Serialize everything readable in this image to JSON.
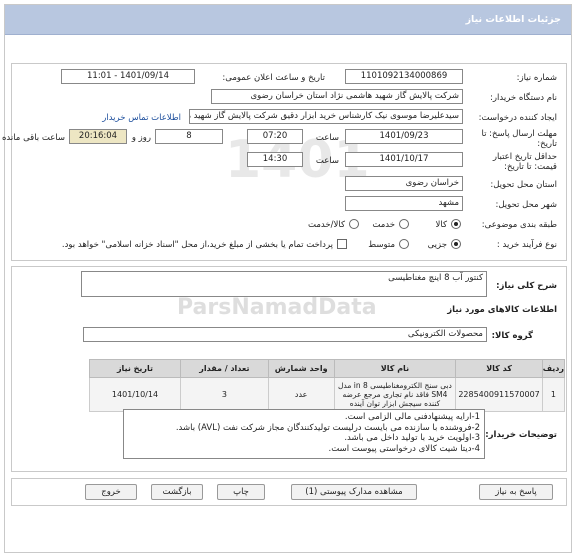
{
  "header": {
    "title": "جزئیات اطلاعات نیاز"
  },
  "fields": {
    "need_number_label": "شماره نیاز:",
    "need_number": "1101092134000869",
    "announce_label": "تاریخ و ساعت اعلان عمومی:",
    "announce_value": "1401/09/14 - 11:01",
    "buyer_org_label": "نام دستگاه خریدار:",
    "buyer_org": "شرکت پالایش گاز شهید هاشمی نژاد   استان خراسان رضوی",
    "creator_label": "ایجاد کننده درخواست:",
    "creator": "سیدعلیرضا موسوی نیک کارشناس خرید ابزار دقیق شرکت پالایش گاز شهید هاشمی نژاد",
    "contact_link": "اطلاعات تماس خریدار",
    "deadline_label": "مهلت ارسال پاسخ: تا تاریخ:",
    "deadline_date": "1401/09/23",
    "time_label": "ساعت",
    "deadline_time": "07:20",
    "days_value": "8",
    "days_label": "روز و",
    "remaining_time": "20:16:04",
    "remaining_label": "ساعت باقی مانده",
    "min_validity_label": "حداقل تاریخ اعتبار قیمت: تا تاریخ:",
    "validity_date": "1401/10/17",
    "validity_time_label": "ساعت",
    "validity_time": "14:30",
    "province_label": "استان محل تحویل:",
    "province": "خراسان رضوی",
    "city_label": "شهر محل تحویل:",
    "city": "مشهد",
    "category_label": "طبقه بندی موضوعی:",
    "category_options": [
      "کالا",
      "خدمت",
      "کالا/خدمت"
    ],
    "process_label": "نوع فرآیند خرید :",
    "process_options": [
      "جزیی",
      "متوسط"
    ],
    "payment_note": "پرداخت تمام یا بخشی از مبلغ خرید،از محل \"اسناد خزانه اسلامی\" خواهد بود."
  },
  "summary": {
    "label": "شرح کلی نیاز:",
    "value": "کنتور آب 8 اینچ مغناطیسی"
  },
  "goods": {
    "section_title": "اطلاعات کالاهای مورد نیاز",
    "group_label": "گروه کالا:",
    "group_value": "محصولات الکترونیکی",
    "columns": [
      "ردیف",
      "کد کالا",
      "نام کالا",
      "واحد شمارش",
      "تعداد / مقدار",
      "تاریخ نیاز"
    ],
    "rows": [
      {
        "row": "1",
        "code": "2285400911570007",
        "name": "دبی سنج الکترومغناطیسی 8 in مدل SM4 فاقد نام تجاری مرجع عرضه کننده سیجش ابزار توان آینده",
        "unit": "عدد",
        "qty": "3",
        "date": "1401/10/14"
      }
    ]
  },
  "notes": {
    "label": "توضیحات خریدار:",
    "lines": [
      "1-ارایه پیشنهادفنی مالی الزامی است.",
      "2-فروشنده با سازنده می بایست درلیست تولیدکنندگان مجاز شرکت نفت (AVL)  باشد.",
      "3-اولویت خرید با  تولید داخل می باشد.",
      "4-دیتا شیت کالای درخواستی پیوست است."
    ]
  },
  "buttons": {
    "reply": "پاسخ به نیاز",
    "attachments": "مشاهده مدارک پیوستی (1)",
    "print": "چاپ",
    "back": "بازگشت",
    "exit": "خروج"
  },
  "colors": {
    "topbar": "#b8c7e0",
    "link": "#1b4d9c",
    "remaining_bg": "#ede6c3"
  }
}
